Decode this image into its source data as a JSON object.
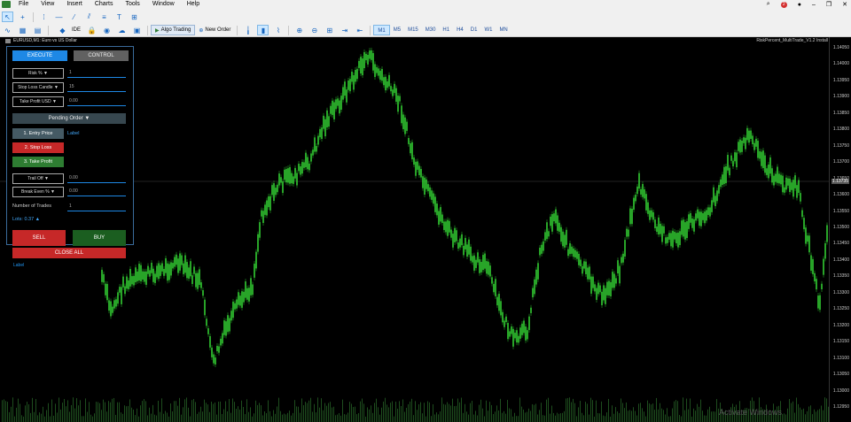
{
  "menu": [
    "File",
    "View",
    "Insert",
    "Charts",
    "Tools",
    "Window",
    "Help"
  ],
  "menu_right": {
    "alerts": "2"
  },
  "toolbar": {
    "algo_trading": "Algo Trading",
    "new_order": "New Order",
    "ide": "IDE",
    "timeframes": [
      "M1",
      "M5",
      "M15",
      "M30",
      "H1",
      "H4",
      "D1",
      "W1",
      "MN"
    ],
    "active_timeframe": "M1"
  },
  "chart": {
    "title": "EURUSD,M1: Euro vs US Dollar",
    "ea_label": "RiskPercent_MultiTrade_V1.2 Install",
    "watermark": "Activate Windows",
    "below_label": "Label",
    "price_labels": [
      "1.14050",
      "1.14000",
      "1.13950",
      "1.13900",
      "1.13850",
      "1.13800",
      "1.13750",
      "1.13700",
      "1.13650",
      "1.13600",
      "1.13550",
      "1.13500",
      "1.13450",
      "1.13400",
      "1.13350",
      "1.13300",
      "1.13250",
      "1.13200",
      "1.13150",
      "1.13100",
      "1.13050",
      "1.13000",
      "1.12950"
    ],
    "current_price": "1.13735",
    "up_color": "#33cc33",
    "volume_color": "#1e4d1e"
  },
  "panel": {
    "tab_execute": "EXECUTE",
    "tab_control": "CONTROL",
    "risk_label": "Risk % ▼",
    "risk_value": "1",
    "sl_label": "Stop Loss Candle ▼",
    "sl_value": "15",
    "tp_label": "Take Profit USD ▼",
    "tp_value": "0.00",
    "pending": "Pending Order ▼",
    "entry": "1. Entry Price",
    "entry_label": "Label",
    "stop": "2. Stop Loss",
    "take": "3. Take Profit",
    "trail_label": "Trail Off ▼",
    "trail_value": "0.00",
    "be_label": "Break Even % ▼",
    "be_value": "0.00",
    "ntrades_label": "Number of Trades",
    "ntrades_value": "1",
    "lots": "Lots: 0.37 ▲",
    "sell": "SELL",
    "buy": "BUY",
    "close_all": "CLOSE ALL"
  }
}
